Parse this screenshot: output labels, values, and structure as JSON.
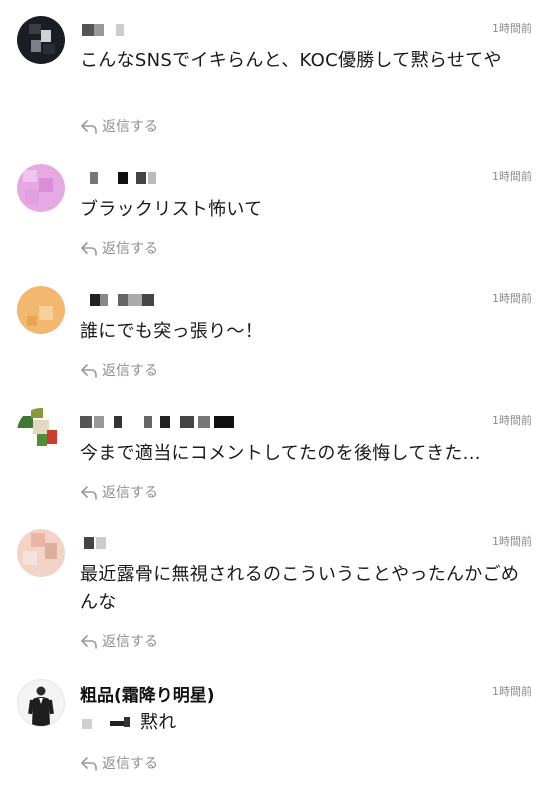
{
  "reply_label": "返信する",
  "comments": [
    {
      "time": "1時間前",
      "text": "こんなSNSでイキらんと、KOC優勝して黙らせてや"
    },
    {
      "time": "1時間前",
      "text": "ブラックリスト怖いて"
    },
    {
      "time": "1時間前",
      "text": "誰にでも突っ張り〜！"
    },
    {
      "time": "1時間前",
      "text": "今まで適当にコメントしてたのを後悔してきた..."
    },
    {
      "time": "1時間前",
      "text": "最近露骨に無視されるのこういうことやったんかごめんな"
    },
    {
      "username": "粗品(霜降り明星)",
      "time": "1時間前",
      "text": "黙れ"
    }
  ],
  "colors": {
    "text": "#1a1a1a",
    "muted": "#8f8f8f",
    "background": "#ffffff"
  },
  "icons": {
    "reply": "reply-arrow-icon"
  }
}
